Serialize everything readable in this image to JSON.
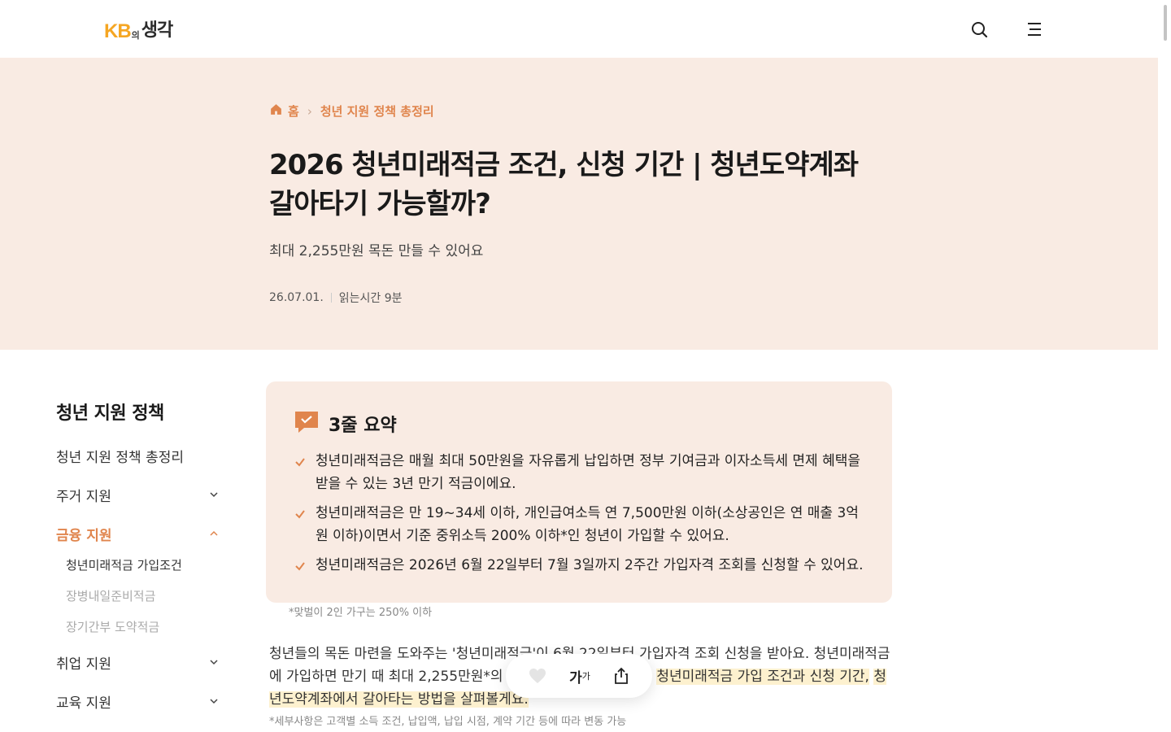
{
  "header": {
    "logo_kb": "KB",
    "logo_ui": "의",
    "logo_thought": "생각",
    "search_icon": "search-icon",
    "menu_icon": "hamburger-menu-icon"
  },
  "hero": {
    "breadcrumb": {
      "home": "홈",
      "current": "청년 지원 정책 총정리"
    },
    "title": "2026 청년미래적금 조건, 신청 기간 | 청년도약계좌 갈아타기 가능할까?",
    "subtitle": "최대 2,255만원 목돈 만들 수 있어요",
    "date": "26.07.01.",
    "read_time": "읽는시간 9분"
  },
  "sidebar": {
    "title": "청년 지원 정책",
    "items": [
      {
        "label": "청년 지원 정책 총정리"
      },
      {
        "label": "주거 지원"
      },
      {
        "label": "금융 지원"
      },
      {
        "label": "취업 지원"
      },
      {
        "label": "교육 지원"
      }
    ],
    "sub_items": [
      {
        "label": "청년미래적금 가입조건"
      },
      {
        "label": "장병내일준비적금"
      },
      {
        "label": "장기간부 도약적금"
      }
    ]
  },
  "summary": {
    "title": "3줄 요약",
    "items": [
      "청년미래적금은 매월 최대 50만원을 자유롭게 납입하면 정부 기여금과 이자소득세 면제 혜택을 받을 수 있는 3년 만기 적금이에요.",
      "청년미래적금은 만 19~34세 이하, 개인급여소득 연 7,500만원 이하(소상공인은 연 매출 3억원 이하)이면서 기준 중위소득 200% 이하*인 청년이 가입할 수 있어요.",
      "청년미래적금은 2026년 6월 22일부터 7월 3일까지 2주간 가입자격 조회를 신청할 수 있어요."
    ],
    "footnote": "*맞벌이 2인 가구는 250% 이하"
  },
  "body": {
    "p1_plain": "청년들의 목돈 마련을 도와주는 '청년미래적금'이 6월 22일부터 가입자격 조회 신청을 받아요. 청년미래적금에 가입하면 만기 때 최대 2,255만원*의 목돈을 만들 수 있는데요. ",
    "p1_highlight_a": "청년미래적금 가입 조건과 신청 기간,",
    "p1_highlight_b": "청년도약계좌에서 갈아타는 방법을 살펴볼게요.",
    "footnote": "*세부사항은 고객별 소득 조건, 납입액, 납입 시점, 계약 기간 등에 따라 변동 가능"
  },
  "floatbar": {
    "like_icon": "heart-icon",
    "font_label": "가",
    "font_sup": "가",
    "share_icon": "share-icon"
  },
  "colors": {
    "accent": "#e0854d",
    "hero_bg": "#f9ebe3",
    "logo_yellow": "#f5a623",
    "highlight": "#fdf1cf"
  }
}
